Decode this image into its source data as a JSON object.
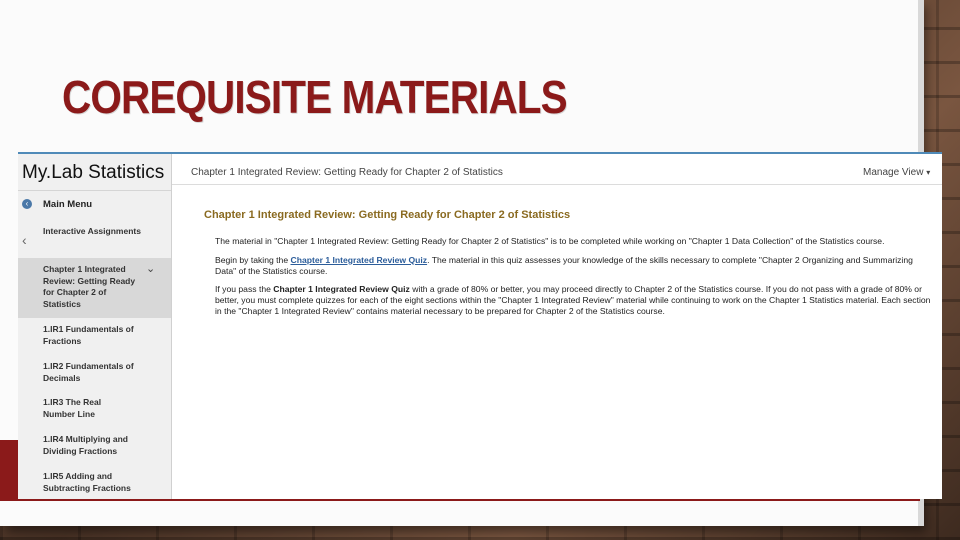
{
  "slide": {
    "title": "COREQUISITE MATERIALS",
    "colors": {
      "accent": "#8b1a1a",
      "heading": "#8a6a20",
      "link": "#2c5d9a"
    }
  },
  "app": {
    "brand": "My.Lab Statistics",
    "breadcrumb": "Chapter 1 Integrated Review: Getting Ready for Chapter 2 of Statistics",
    "manage_view": "Manage View",
    "sidebar": {
      "main_menu": "Main Menu",
      "items": [
        {
          "label": "Interactive Assignments"
        },
        {
          "label": "Chapter 1 Integrated Review: Getting Ready for Chapter 2 of Statistics"
        },
        {
          "label": "1.IR1 Fundamentals of Fractions"
        },
        {
          "label": "1.IR2 Fundamentals of Decimals"
        },
        {
          "label": "1.IR3 The Real Number Line"
        },
        {
          "label": "1.IR4 Multiplying and Dividing Fractions"
        },
        {
          "label": "1.IR5 Adding and Subtracting Fractions"
        }
      ]
    },
    "content": {
      "heading": "Chapter 1 Integrated Review: Getting Ready for Chapter 2 of Statistics",
      "p1": "The material in \"Chapter 1 Integrated Review: Getting Ready for Chapter 2 of Statistics\" is to be completed while working on \"Chapter 1 Data Collection\" of the Statistics course.",
      "p2_before": "Begin by taking the ",
      "p2_link": "Chapter 1 Integrated Review Quiz",
      "p2_after": ". The material in this quiz assesses your knowledge of the skills necessary to complete \"Chapter 2 Organizing and Summarizing Data\" of the Statistics course.",
      "p3_before": "If you pass the ",
      "p3_bold": "Chapter 1 Integrated Review Quiz",
      "p3_after": " with a grade of 80% or better, you may proceed directly to Chapter 2 of the Statistics course. If you do not pass with a grade of 80% or better, you must complete quizzes for each of the eight sections within the \"Chapter 1 Integrated Review\" material while continuing to work on the Chapter 1 Statistics material. Each section in the \"Chapter 1 Integrated Review\" contains material necessary to be prepared for Chapter 2 of the Statistics course."
    }
  }
}
